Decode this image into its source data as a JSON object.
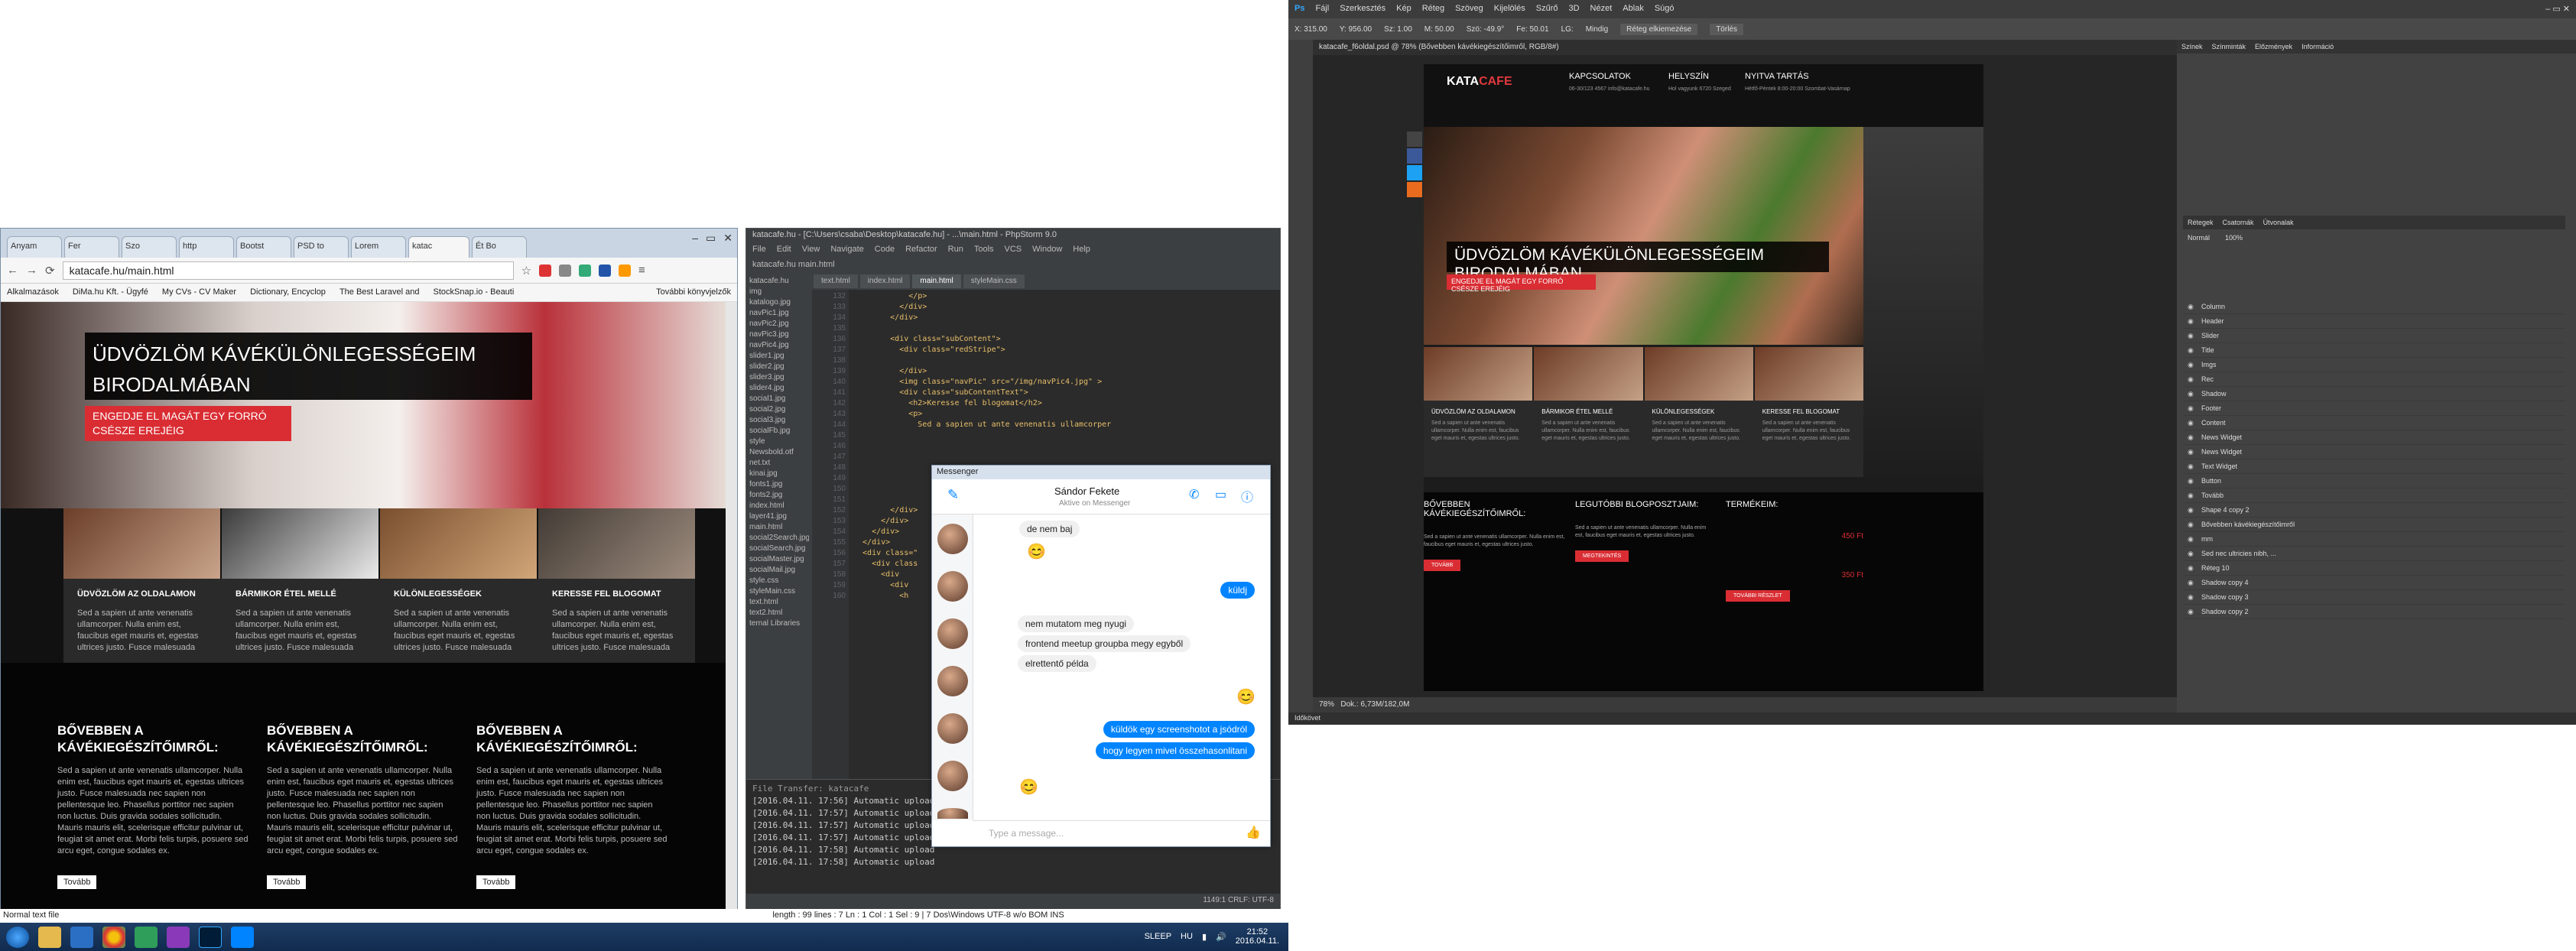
{
  "chrome": {
    "tabs": [
      "Anyam",
      "Fer",
      "Szo",
      "http",
      "Bootst",
      "PSD to",
      "Lorem",
      "katac",
      "Ét Bo"
    ],
    "url": "katacafe.hu/main.html",
    "bookmarks": [
      "Alkalmazások",
      "DiMa.hu Kft. - Ügyfé",
      "My CVs - CV Maker",
      "Dictionary, Encyclop",
      "The Best Laravel and",
      "StockSnap.io - Beauti",
      "További könyvjelzők"
    ],
    "hero_title": "ÜDVÖZLÖM KÁVÉKÜLÖNLEGESSÉGEIM BIRODALMÁBAN",
    "hero_sub": "ENGEDJE EL MAGÁT EGY FORRÓ CSÉSZE EREJÉIG",
    "columns": [
      {
        "title": "ÜDVÖZLÖM AZ OLDALAMON",
        "text": "Sed a sapien ut ante venenatis ullamcorper. Nulla enim est, faucibus eget mauris et, egestas ultrices justo. Fusce malesuada"
      },
      {
        "title": "BÁRMIKOR ÉTEL MELLÉ",
        "text": "Sed a sapien ut ante venenatis ullamcorper. Nulla enim est, faucibus eget mauris et, egestas ultrices justo. Fusce malesuada"
      },
      {
        "title": "KÜLÖNLEGESSÉGEK",
        "text": "Sed a sapien ut ante venenatis ullamcorper. Nulla enim est, faucibus eget mauris et, egestas ultrices justo. Fusce malesuada"
      },
      {
        "title": "KERESSE FEL BLOGOMAT",
        "text": "Sed a sapien ut ante venenatis ullamcorper. Nulla enim est, faucibus eget mauris et, egestas ultrices justo. Fusce malesuada"
      }
    ],
    "blocks": [
      {
        "title": "BŐVEBBEN A KÁVÉKIEGÉSZÍTŐIMRŐL:",
        "text": "Sed a sapien ut ante venenatis ullamcorper. Nulla enim est, faucibus eget mauris et, egestas ultrices justo. Fusce malesuada nec sapien non pellentesque leo. Phasellus porttitor nec sapien non luctus. Duis gravida sodales sollicitudin. Mauris mauris elit, scelerisque efficitur pulvinar ut, feugiat sit amet erat. Morbi felis turpis, posuere sed arcu eget, congue sodales ex.",
        "btn": "Tovább"
      },
      {
        "title": "BŐVEBBEN A KÁVÉKIEGÉSZÍTŐIMRŐL:",
        "text": "Sed a sapien ut ante venenatis ullamcorper. Nulla enim est, faucibus eget mauris et, egestas ultrices justo. Fusce malesuada nec sapien non pellentesque leo. Phasellus porttitor nec sapien non luctus. Duis gravida sodales sollicitudin. Mauris mauris elit, scelerisque efficitur pulvinar ut, feugiat sit amet erat. Morbi felis turpis, posuere sed arcu eget, congue sodales ex.",
        "btn": "Tovább"
      },
      {
        "title": "BŐVEBBEN A KÁVÉKIEGÉSZÍTŐIMRŐL:",
        "text": "Sed a sapien ut ante venenatis ullamcorper. Nulla enim est, faucibus eget mauris et, egestas ultrices justo. Fusce malesuada nec sapien non pellentesque leo. Phasellus porttitor nec sapien non luctus. Duis gravida sodales sollicitudin. Mauris mauris elit, scelerisque efficitur pulvinar ut, feugiat sit amet erat. Morbi felis turpis, posuere sed arcu eget, congue sodales ex.",
        "btn": "Tovább"
      }
    ],
    "status": "Normal text file"
  },
  "phpstorm": {
    "title": "katacafe.hu - [C:\\Users\\csaba\\Desktop\\katacafe.hu] - ...\\main.html - PhpStorm 9.0",
    "menu": [
      "File",
      "Edit",
      "View",
      "Navigate",
      "Code",
      "Refactor",
      "Run",
      "Tools",
      "VCS",
      "Window",
      "Help"
    ],
    "nav": "katacafe.hu  main.html",
    "tabs": [
      "text.html",
      "index.html",
      "main.html",
      "styleMain.css"
    ],
    "tree": [
      "katacafe.hu",
      "img",
      "katalogo.jpg",
      "navPic1.jpg",
      "navPic2.jpg",
      "navPic3.jpg",
      "navPic4.jpg",
      "slider1.jpg",
      "slider2.jpg",
      "slider3.jpg",
      "slider4.jpg",
      "social1.jpg",
      "social2.jpg",
      "social3.jpg",
      "socialFb.jpg",
      "style",
      "Newsbold.otf",
      "net.txt",
      "kinai.jpg",
      "fonts1.jpg",
      "fonts2.jpg",
      "index.html",
      "layer41.jpg",
      "main.html",
      "social2Search.jpg",
      "socialSearch.jpg",
      "socialMaster.jpg",
      "socialMail.jpg",
      "style.css",
      "styleMain.css",
      "text.html",
      "text2.html",
      "ternal Libraries"
    ],
    "lines": [
      "132",
      "133",
      "134",
      "135",
      "136",
      "137",
      "138",
      "139",
      "140",
      "141",
      "142",
      "143",
      "144",
      "145",
      "146",
      "147",
      "148",
      "149",
      "150",
      "151",
      "152",
      "153",
      "154",
      "155",
      "156",
      "157",
      "158",
      "159",
      "160"
    ],
    "code": [
      "            </p>",
      "          </div>",
      "        </div>",
      "",
      "        <div class=\"subContent\">",
      "          <div class=\"redStripe\">",
      "",
      "          </div>",
      "          <img class=\"navPic\" src=\"/img/navPic4.jpg\" >",
      "          <div class=\"subContentText\">",
      "            <h2>Keresse fel blogomat</h2>",
      "            <p>",
      "              Sed a sapien ut ante venenatis ullamcorper",
      "",
      "",
      "",
      "",
      "",
      "",
      "",
      "        </div>",
      "      </div>",
      "    </div>",
      "  </div>",
      "  <div class=\"",
      "    <div class",
      "      <div",
      "        <div",
      "          <h"
    ],
    "console_title": "File Transfer: katacafe",
    "console": [
      "[2016.04.11. 17:56] Automatic upload",
      "[2016.04.11. 17:57] Automatic upload",
      "[2016.04.11. 17:57] Automatic upload",
      "[2016.04.11. 17:57] Automatic upload",
      "[2016.04.11. 17:58] Automatic upload",
      "[2016.04.11. 17:58] Automatic upload"
    ],
    "status": "1149:1  CRLF:  UTF-8",
    "bottom_status": "length : 99    lines : 7                    Ln : 1    Col : 1    Sel : 9 | 7                    Dos\\Windows       UTF-8 w/o BOM       INS"
  },
  "messenger": {
    "title": "Messenger",
    "name": "Sándor Fekete",
    "active": "Aktive on Messenger",
    "messages_left": [
      "de nem baj",
      "nem mutatom meg nyugi",
      "frontend meetup groupba megy egyből",
      "elrettentő példa"
    ],
    "messages_right": [
      "küldj",
      "küldök egy screenshotot a jsódról",
      "hogy legyen mivel összehasonlitani"
    ],
    "input_placeholder": "Type a message..."
  },
  "taskbar": {
    "lang": "HU",
    "sleep": "SLEEP",
    "time": "21:52",
    "date": "2016.04.11."
  },
  "photoshop": {
    "menu": [
      "Fájl",
      "Szerkesztés",
      "Kép",
      "Réteg",
      "Szöveg",
      "Kijelölés",
      "Szűrő",
      "3D",
      "Nézet",
      "Ablak",
      "Súgó"
    ],
    "options": [
      "X: 315.00",
      "Y: 956.00",
      "Sz: 1.00",
      "M: 50.00",
      "Szö: -49.9°",
      "Fe: 50.01",
      "LG:",
      "Mindig",
      "Réteg elkiemezése",
      "Törlés"
    ],
    "doc_tab": "katacafe_f6oldal.psd @ 78% (Bővebben kávékiegészítőimről, RGB/8#)",
    "site": {
      "logo_a": "KATA",
      "logo_b": "CAFE",
      "cols": [
        {
          "t": "KAPCSOLATOK",
          "s": "06-30/123 4567 info@katacafe.hu"
        },
        {
          "t": "HELYSZÍN",
          "s": "Hol vagyunk 6720 Szeged"
        },
        {
          "t": "NYITVA TARTÁS",
          "s": "Hétfő-Péntek 8:00-20:00 Szombat-Vasárnap"
        }
      ],
      "hero": "ÜDVÖZLÖM KÁVÉKÜLÖNLEGESSÉGEIM BIRODALMÁBAN",
      "hero_sub": "ENGEDJE EL MAGÁT EGY FORRÓ CSÉSZE EREJÉIG",
      "cols4": [
        "ÜDVÖZLÖM AZ OLDALAMON",
        "BÁRMIKOR ÉTEL MELLÉ",
        "KÜLÖNLEGESSÉGEK",
        "KERESSE FEL BLOGOMAT"
      ],
      "lorem": "Sed a sapien ut ante venenatis ullamcorper. Nulla enim est, faucibus eget mauris et, egestas ultrices justo.",
      "b1": "BŐVEBBEN KÁVÉKIEGÉSZÍTŐIMRŐL:",
      "b2": "LEGUTÓBBI BLOGPOSZTJAIM:",
      "b3": "TERMÉKEIM:",
      "btn1": "TOVÁBB",
      "btn2": "MEGTEKINTÉS",
      "btn3": "TOVÁBBI RÉSZLET",
      "price1": "450 Ft",
      "price2": "350 Ft"
    },
    "zoom": "78%",
    "doc": "Dok.: 6,73M/182,0M",
    "bottom": "Időkövet",
    "right_tabs": [
      "Színek",
      "Színminták",
      "Előzmények",
      "Információ"
    ],
    "layer_tabs": [
      "Rétegek",
      "Csatornák",
      "Útvonalak"
    ],
    "mode": "Normál",
    "opacity": "100%",
    "layers": [
      "Column",
      "Header",
      "Slider",
      "Title",
      "Imgs",
      "Rec",
      "Shadow",
      "Footer",
      "Content",
      "News Widget",
      "News Widget",
      "Text Widget",
      "Button",
      "Tovább",
      "Shape 4 copy 2",
      "Bővebben kávékiegészítőimről",
      "mm",
      "Sed nec ultricies nibh, ...",
      "Réteg 10",
      "Shadow copy 4",
      "Shadow copy 3",
      "Shadow copy 2"
    ]
  }
}
